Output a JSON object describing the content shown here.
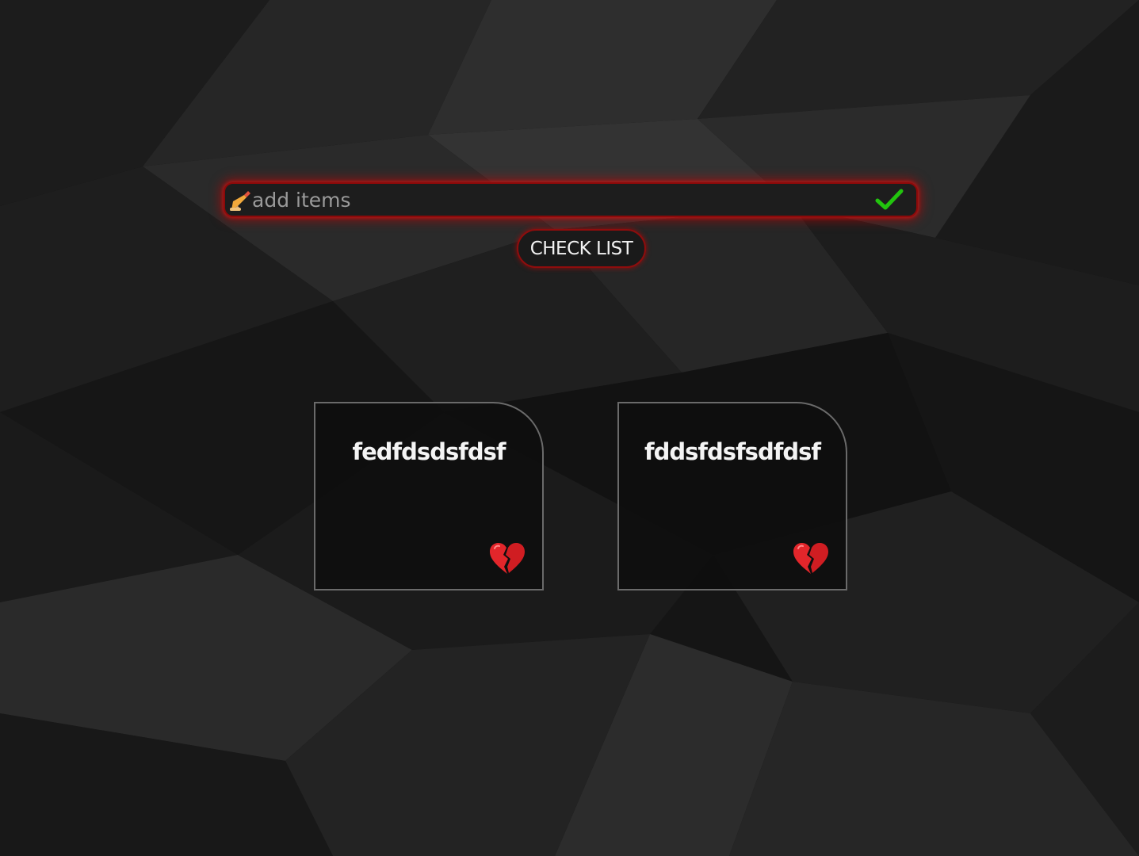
{
  "add_item": {
    "placeholder": "add items",
    "value": "",
    "leading_icon": "writing-hand-icon",
    "submit_icon": "checkmark-icon",
    "glow_color": "#d10000",
    "check_color": "#22c40e"
  },
  "check_list_button": {
    "label": "CHECK LIST"
  },
  "items": [
    {
      "title": "fedfdsdsfdsf",
      "delete_icon": "broken-heart-icon"
    },
    {
      "title": "fddsfdsfsdfdsf",
      "delete_icon": "broken-heart-icon"
    }
  ],
  "colors": {
    "background": "#141414",
    "accent": "#c40000",
    "card_border": "#6a6a6a",
    "text": "#f4f4f4"
  }
}
